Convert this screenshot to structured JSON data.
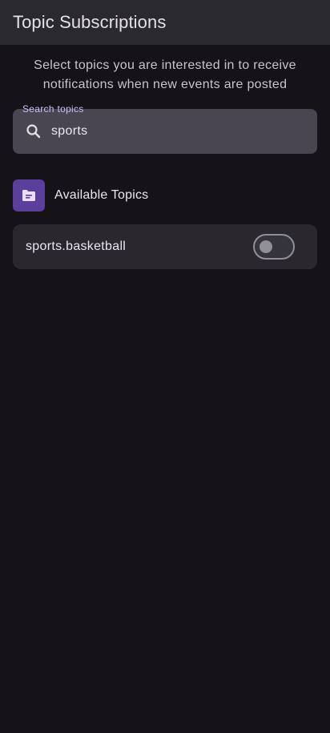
{
  "app_bar": {
    "title": "Topic Subscriptions"
  },
  "description": "Select topics you are interested in to receive notifications when new events are posted",
  "search": {
    "label": "Search topics",
    "value": "sports",
    "icon": "search-icon"
  },
  "section": {
    "title": "Available Topics",
    "icon": "folder-icon"
  },
  "topics": [
    {
      "label": "sports.basketball",
      "subscribed": false
    }
  ],
  "colors": {
    "background": "#151218",
    "app_bar": "#2b2930",
    "accent": "#d0bcff",
    "badge": "#5b3f9a",
    "card": "#2a282e",
    "field": "#4a4651"
  }
}
